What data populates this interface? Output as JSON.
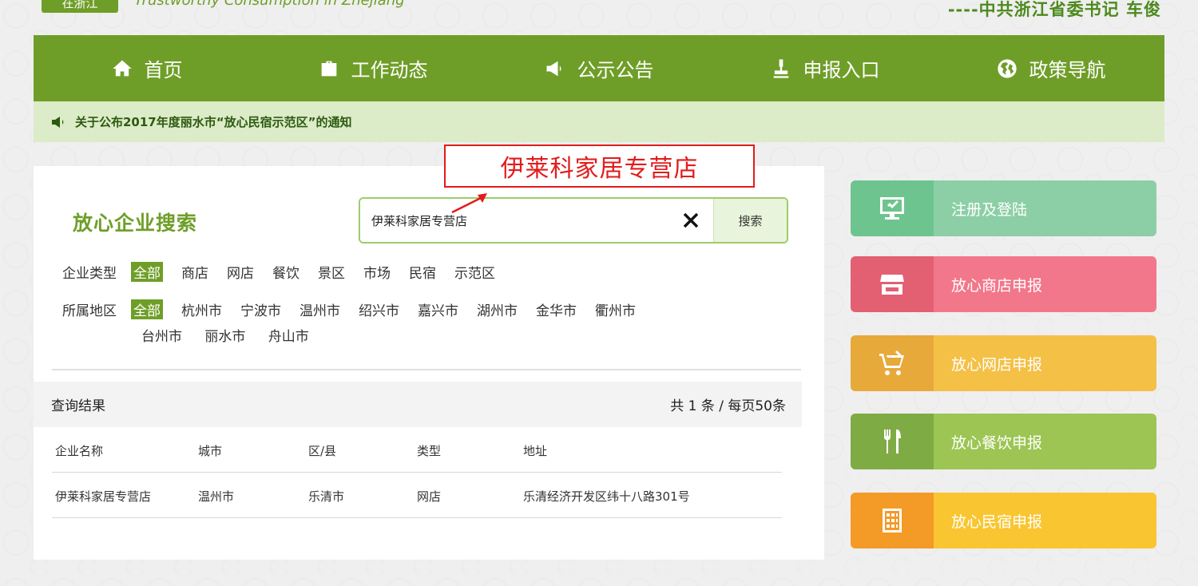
{
  "header": {
    "logo_badge": "在浙江",
    "slogan": "Trustworthy Consumption in Zhejiang",
    "quote": "----中共浙江省委书记 车俊"
  },
  "nav": {
    "items": [
      {
        "label": "首页",
        "icon": "home-icon"
      },
      {
        "label": "工作动态",
        "icon": "briefcase-icon"
      },
      {
        "label": "公示公告",
        "icon": "megaphone-icon"
      },
      {
        "label": "申报入口",
        "icon": "stamp-icon"
      },
      {
        "label": "政策导航",
        "icon": "globe-icon"
      }
    ]
  },
  "notice": {
    "icon": "speaker-icon",
    "text": "关于公布2017年度丽水市“放心民宿示范区”的通知"
  },
  "annotation": {
    "text": "伊莱科家居专营店",
    "color": "#e21b1b"
  },
  "search": {
    "title": "放心企业搜索",
    "value": "伊莱科家居专营店",
    "clear_icon": "close-icon",
    "button_label": "搜索"
  },
  "filters": {
    "type": {
      "label": "企业类型",
      "options": [
        "全部",
        "商店",
        "网店",
        "餐饮",
        "景区",
        "市场",
        "民宿",
        "示范区"
      ],
      "active": "全部"
    },
    "region": {
      "label": "所属地区",
      "options_row1": [
        "全部",
        "杭州市",
        "宁波市",
        "温州市",
        "绍兴市",
        "嘉兴市",
        "湖州市",
        "金华市",
        "衢州市"
      ],
      "options_row2": [
        "台州市",
        "丽水市",
        "舟山市"
      ],
      "active": "全部"
    }
  },
  "results": {
    "title": "查询结果",
    "count": "共 1 条 / 每页50条",
    "columns": [
      "企业名称",
      "城市",
      "区/县",
      "类型",
      "地址"
    ],
    "rows": [
      [
        "伊莱科家居专营店",
        "温州市",
        "乐清市",
        "网店",
        "乐清经济开发区纬十八路301号"
      ]
    ]
  },
  "sidebar": {
    "buttons": [
      {
        "label": "注册及登陆",
        "icon": "monitor-icon",
        "icon_bg": "#6ec48e",
        "label_bg": "#8ccfa6"
      },
      {
        "label": "放心商店申报",
        "icon": "store-icon",
        "icon_bg": "#e35f72",
        "label_bg": "#f2778a"
      },
      {
        "label": "放心网店申报",
        "icon": "cart-icon",
        "icon_bg": "#e7a93a",
        "label_bg": "#f4c046"
      },
      {
        "label": "放心餐饮申报",
        "icon": "fork-knife-icon",
        "icon_bg": "#7fab45",
        "label_bg": "#9cc553"
      },
      {
        "label": "放心民宿申报",
        "icon": "building-icon",
        "icon_bg": "#f49a26",
        "label_bg": "#f9c631"
      }
    ]
  }
}
